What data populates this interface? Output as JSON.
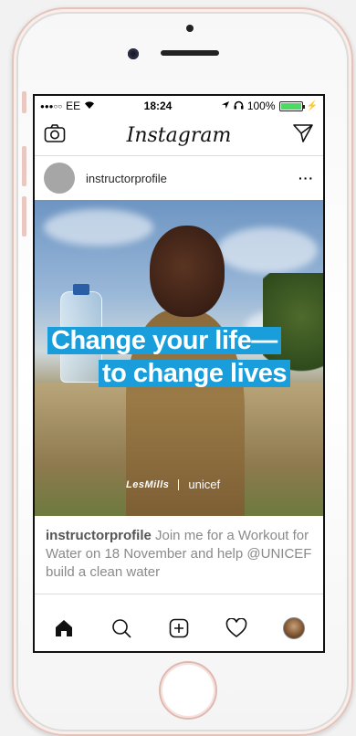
{
  "status_bar": {
    "carrier": "EE",
    "time": "18:24",
    "battery": "100%",
    "battery_level": 1.0
  },
  "app": {
    "title": "Instagram"
  },
  "post": {
    "username": "instructorprofile",
    "more": "···",
    "image": {
      "headline_line1": "Change your life—",
      "headline_line2": "to change lives",
      "brand_left": "LesMills",
      "brand_right": "unicef"
    },
    "caption_user": "instructorprofile",
    "caption_text": " Join me for a Workout for Water on 18 November and help @UNICEF build a clean water"
  },
  "icons": {
    "camera": "camera-icon",
    "direct": "direct-message-icon",
    "home": "home-icon",
    "search": "search-icon",
    "add": "add-post-icon",
    "activity": "heart-icon",
    "profile": "profile-avatar"
  },
  "colors": {
    "headline_bg": "#1a9ddb",
    "battery": "#4cd964"
  }
}
